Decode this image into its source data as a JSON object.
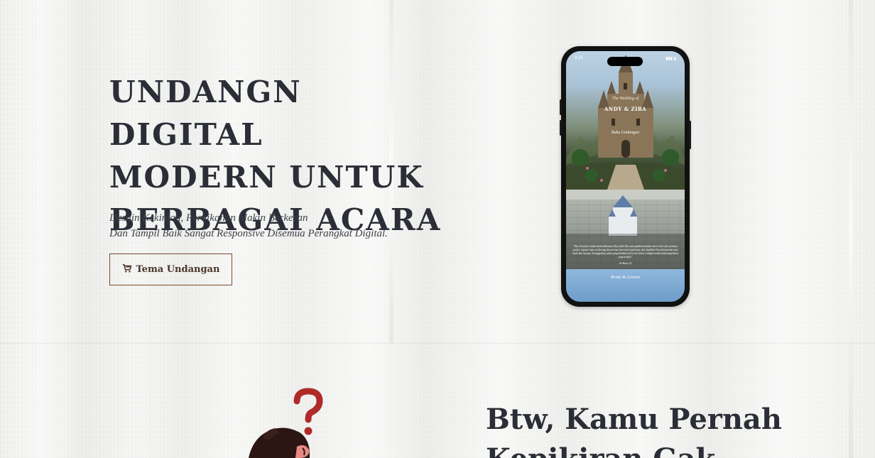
{
  "hero": {
    "title": "UNDANGN DIGITAL MODERN UNTUK BERBAGAI ACARA",
    "subtitle_line1": "Desain Kekinian, Pernikahan Makin Berkesan",
    "subtitle_line2": "Dan Tampil Baik Sangat Responsive Disemua Perangkat Digital.",
    "cta_label": "Tema Undangan",
    "cta_icon": "cart-icon"
  },
  "phone_preview": {
    "status_time": "9:24",
    "status_icons": "▮▮▮ ▮",
    "couple_pre": "The Wedding of",
    "couple_names": "ANDY & ZIRA",
    "open_label": "Buka Undangan",
    "quote": "\"Dan di antara tanda-tanda kekuasaan-Nya ialah Dia menciptakan untukmu isteri-isteri dari jenismu sendiri, supaya kamu cenderung dan merasa tenteram kepadanya, dan dijadikan-Nya diantaramu rasa kasih dan sayang. Sesungguhnya pada yang demikian itu benar-benar terdapat tanda-tanda bagi kaum yang berfikir\"",
    "quote_source": "Ar-Rum:21",
    "section_label": "Bride & Groom"
  },
  "section2": {
    "title": "Btw, Kamu Pernah Kepikiran Gak"
  },
  "colors": {
    "text_dark": "#2b2e36",
    "cta_border": "#7a4a2e",
    "question_mark": "#b02a2a"
  }
}
